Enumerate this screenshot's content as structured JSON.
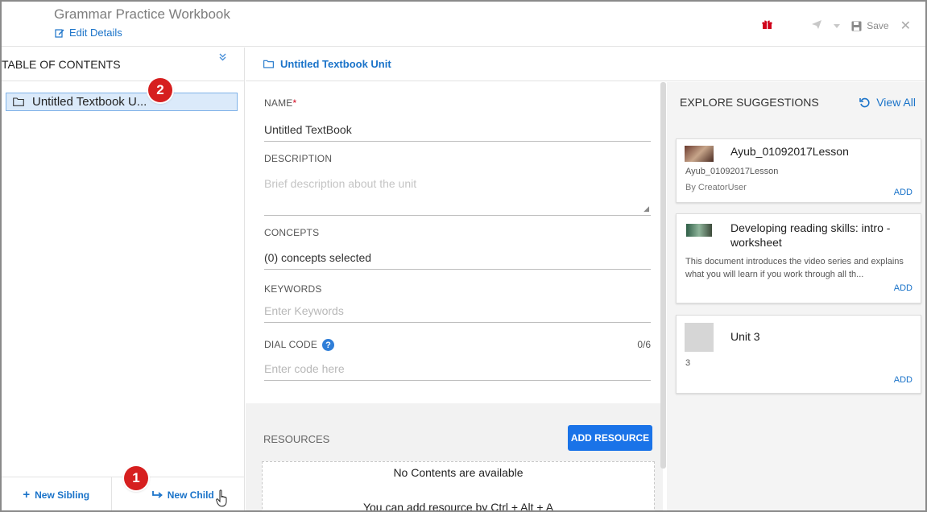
{
  "header": {
    "workbook_title": "Grammar Practice Workbook",
    "edit_details": "Edit Details",
    "save_label": "Save"
  },
  "toc": {
    "title": "TABLE OF CONTENTS",
    "items": [
      {
        "label": "Untitled Textbook U...",
        "selected": true
      }
    ],
    "new_sibling": "New Sibling",
    "new_child": "New Child"
  },
  "callouts": {
    "one": "1",
    "two": "2"
  },
  "unit": {
    "title": "Untitled Textbook Unit",
    "name_label": "NAME",
    "name_required": "*",
    "name_value": "Untitled TextBook",
    "description_label": "DESCRIPTION",
    "description_placeholder": "Brief description about the unit",
    "concepts_label": "CONCEPTS",
    "concepts_value": "(0) concepts selected",
    "keywords_label": "KEYWORDS",
    "keywords_placeholder": "Enter Keywords",
    "dial_code_label": "DIAL CODE",
    "dial_code_count": "0/6",
    "dial_code_placeholder": "Enter code here"
  },
  "resources": {
    "label": "RESOURCES",
    "add_button": "ADD RESOURCE",
    "empty_title": "No Contents are available",
    "empty_hint": "You can add resource by Ctrl + Alt + A"
  },
  "explore": {
    "title": "EXPLORE SUGGESTIONS",
    "view_all": "View All",
    "add_label": "ADD",
    "cards": [
      {
        "title": "Ayub_01092017Lesson",
        "subtitle": "Ayub_01092017Lesson",
        "author": "By CreatorUser"
      },
      {
        "title": "Developing reading skills: intro - worksheet",
        "description": "This document introduces the video series and explains what you will learn if you work through all th..."
      },
      {
        "title": "Unit 3",
        "subtitle": "3"
      }
    ]
  },
  "colors": {
    "accent": "#1a73c9",
    "button_blue": "#1a73e8",
    "callout_red": "#d61f1f",
    "selection_bg": "#dbeafa"
  }
}
